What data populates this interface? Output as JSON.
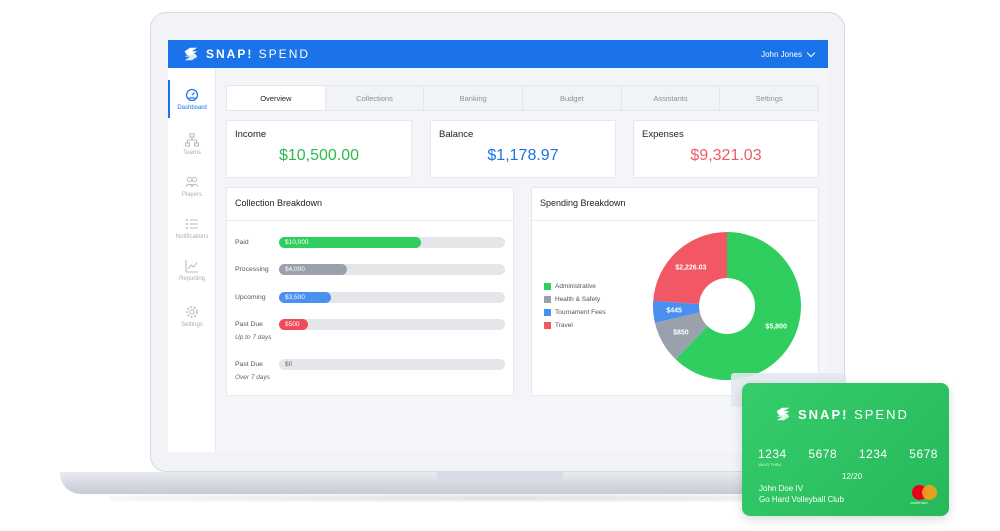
{
  "app": {
    "brand_strong": "SNAP!",
    "brand_light": " SPEND",
    "user_name": "John Jones"
  },
  "sidebar": {
    "items": [
      {
        "label": "Dashboard",
        "icon": "dashboard-icon",
        "active": true
      },
      {
        "label": "Teams",
        "icon": "teams-icon"
      },
      {
        "label": "Players",
        "icon": "players-icon"
      },
      {
        "label": "Notifications",
        "icon": "notifications-icon"
      },
      {
        "label": "Reporting",
        "icon": "reporting-icon"
      },
      {
        "label": "Settings",
        "icon": "settings-icon"
      }
    ]
  },
  "tabs": [
    "Overview",
    "Collections",
    "Banking",
    "Budget",
    "Assistants",
    "Settings"
  ],
  "stats": {
    "income": {
      "label": "Income",
      "value": "$10,500.00",
      "color": "#2db84c"
    },
    "balance": {
      "label": "Balance",
      "value": "$1,178.97",
      "color": "#1a73e8"
    },
    "expenses": {
      "label": "Expenses",
      "value": "$9,321.03",
      "color": "#ef5a6a"
    }
  },
  "collection": {
    "title": "Collection Breakdown",
    "rows": [
      {
        "label": "Paid",
        "value": "$10,000",
        "fraction": 0.63,
        "color": "#2fce5e"
      },
      {
        "label": "Processing",
        "value": "$4,000",
        "fraction": 0.3,
        "color": "#9aa1ad"
      },
      {
        "label": "Upcoming",
        "value": "$3,500",
        "fraction": 0.23,
        "color": "#4a90f0"
      },
      {
        "label": "Past Due",
        "sub": "Up to 7 days",
        "value": "$500",
        "fraction": 0.13,
        "color": "#ef4b5a"
      },
      {
        "label": "Past Due",
        "sub": "Over 7 days",
        "value": "$0",
        "fraction": 0.0,
        "color": "#9aa1ad"
      }
    ]
  },
  "spending": {
    "title": "Spending Breakdown"
  },
  "chart_data": {
    "type": "pie",
    "title": "Spending Breakdown",
    "slices": [
      {
        "name": "Administrative",
        "value": 5800,
        "label": "$5,800",
        "color": "#2fce5e"
      },
      {
        "name": "Health & Safety",
        "value": 850,
        "label": "$850",
        "color": "#9aa1ad"
      },
      {
        "name": "Tournament Fees",
        "value": 445,
        "label": "$445",
        "color": "#4a90f0"
      },
      {
        "name": "Travel",
        "value": 2226.03,
        "label": "$2,226.03",
        "color": "#f25766"
      }
    ],
    "legend_position": "left"
  },
  "card": {
    "brand_strong": "SNAP!",
    "brand_light": " SPEND",
    "number_groups": [
      "1234",
      "5678",
      "1234",
      "5678"
    ],
    "valid_label": "VALID THRU",
    "expiry": "12/20",
    "holder": "John Doe IV",
    "club": "Go Hard Volleyball Club",
    "network": "mastercard"
  }
}
